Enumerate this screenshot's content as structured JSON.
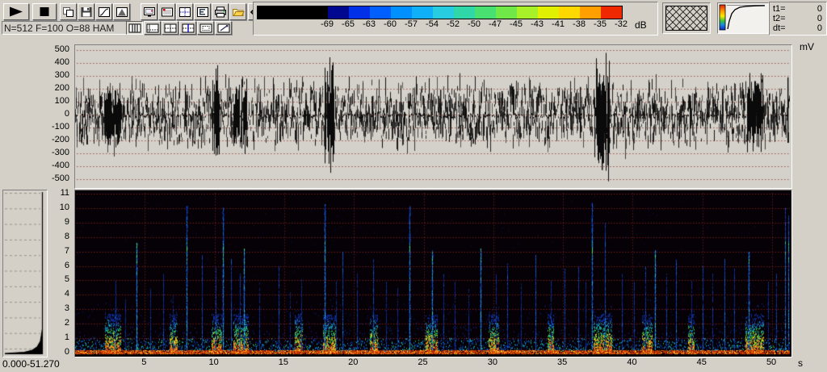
{
  "toolbar": {
    "status_text": "N=512 F=100 O=88 HAM",
    "row1_icons": [
      "play",
      "stop",
      "copy",
      "save",
      "function-curve",
      "triangle-window",
      "display",
      "sonagram-settings",
      "grid-display",
      "fft-params",
      "print",
      "open-file",
      "prev",
      "next"
    ],
    "row2_icons": [
      "view-oscillogram",
      "view-spectrogram",
      "view-split",
      "view-split-cursor",
      "view-zoom",
      "edit-annotate"
    ]
  },
  "colorbar": {
    "unit": "dB",
    "labels": [
      "-69",
      "-65",
      "-63",
      "-60",
      "-57",
      "-54",
      "-52",
      "-50",
      "-47",
      "-45",
      "-43",
      "-41",
      "-38",
      "-35",
      "-32"
    ],
    "lead_color": "#000000",
    "segment_colors": [
      "#000890",
      "#0030e8",
      "#0060ff",
      "#0090ff",
      "#10b0f8",
      "#28cce0",
      "#30d8a8",
      "#48e070",
      "#70e848",
      "#a8f028",
      "#e0f000",
      "#ffd800",
      "#ffa000",
      "#f02800"
    ]
  },
  "cursor_readout": {
    "rows": [
      {
        "label": "t1=",
        "value": "0"
      },
      {
        "label": "t2=",
        "value": "0"
      },
      {
        "label": "dt=",
        "value": "0"
      }
    ]
  },
  "oscillogram": {
    "unit": "mV",
    "y_ticks": [
      "500",
      "400",
      "300",
      "200",
      "100",
      "0",
      "-100",
      "-200",
      "-300",
      "-400",
      "-500"
    ],
    "bg": "#d4d1ca",
    "grid_color": "#a85a4e"
  },
  "spectrogram": {
    "y_ticks": [
      "11",
      "10",
      "9",
      "8",
      "7",
      "6",
      "5",
      "4",
      "3",
      "2",
      "1",
      "0"
    ],
    "x_ticks": [
      "5",
      "10",
      "15",
      "20",
      "25",
      "30",
      "35",
      "40",
      "45",
      "50"
    ],
    "x_unit": "s",
    "range_label": "0.000-51.270",
    "bg": "#060106",
    "grid_color": "#d73c32"
  },
  "chart_data": [
    {
      "type": "line",
      "name": "oscillogram",
      "ylabel": "mV",
      "ylim": [
        -500,
        500
      ],
      "t_range_s": [
        0,
        51.27
      ],
      "noise_band_mv": 90,
      "bursts": [
        [
          2.1,
          3.25,
          190
        ],
        [
          9.9,
          10.35,
          370
        ],
        [
          11.45,
          11.8,
          260
        ],
        [
          11.95,
          12.3,
          280
        ],
        [
          17.95,
          18.55,
          330
        ],
        [
          37.3,
          38.3,
          380
        ],
        [
          48.25,
          49.35,
          270
        ]
      ],
      "spikes": [
        [
          4.5,
          150
        ],
        [
          5.9,
          120
        ],
        [
          7.9,
          200
        ],
        [
          14.2,
          150
        ],
        [
          16.5,
          120
        ],
        [
          21.3,
          160
        ],
        [
          23.0,
          130
        ],
        [
          26.2,
          220
        ],
        [
          26.9,
          140
        ],
        [
          28.0,
          130
        ],
        [
          30.6,
          200
        ],
        [
          33.1,
          150
        ],
        [
          35.2,
          140
        ],
        [
          36.2,
          250
        ],
        [
          37.75,
          -450
        ],
        [
          40.3,
          180
        ],
        [
          42.0,
          140
        ],
        [
          44.1,
          160
        ],
        [
          45.3,
          130
        ],
        [
          46.4,
          200
        ],
        [
          47.1,
          150
        ],
        [
          50.3,
          160
        ],
        [
          51.1,
          330
        ]
      ]
    },
    {
      "type": "heatmap",
      "name": "spectrogram",
      "f_range_khz": [
        0,
        11
      ],
      "t_range_s": [
        0,
        51.27
      ],
      "x_ticks_s": [
        5,
        10,
        15,
        20,
        25,
        30,
        35,
        40,
        45,
        50
      ],
      "y_ticks_khz": [
        0,
        1,
        2,
        3,
        4,
        5,
        6,
        7,
        8,
        9,
        10,
        11
      ],
      "bottom_band_khz": 0.15,
      "calls": [
        [
          2.9,
          5.0,
          0.45
        ],
        [
          3.6,
          4.0,
          0.35
        ],
        [
          4.4,
          7.6,
          0.95
        ],
        [
          5.4,
          4.5,
          0.4
        ],
        [
          6.3,
          5.5,
          0.45
        ],
        [
          7.0,
          4.0,
          0.35
        ],
        [
          8.0,
          10.2,
          0.9
        ],
        [
          9.1,
          6.8,
          0.5
        ],
        [
          10.1,
          6.0,
          0.5
        ],
        [
          10.6,
          10.1,
          0.85
        ],
        [
          11.2,
          6.5,
          0.55
        ],
        [
          11.8,
          5.5,
          0.5
        ],
        [
          12.1,
          7.2,
          0.95
        ],
        [
          13.2,
          5.0,
          0.4
        ],
        [
          14.6,
          6.0,
          0.5
        ],
        [
          15.4,
          4.5,
          0.35
        ],
        [
          16.2,
          5.2,
          0.4
        ],
        [
          17.9,
          10.3,
          0.9
        ],
        [
          18.7,
          5.0,
          0.4
        ],
        [
          19.2,
          7.0,
          0.6
        ],
        [
          20.2,
          5.5,
          0.45
        ],
        [
          21.4,
          6.5,
          0.55
        ],
        [
          22.3,
          5.0,
          0.4
        ],
        [
          23.1,
          4.5,
          0.35
        ],
        [
          24.0,
          10.2,
          0.9
        ],
        [
          25.6,
          7.1,
          0.95
        ],
        [
          26.4,
          5.5,
          0.45
        ],
        [
          27.2,
          5.0,
          0.4
        ],
        [
          28.2,
          4.5,
          0.35
        ],
        [
          29.1,
          7.2,
          0.9
        ],
        [
          30.2,
          5.5,
          0.4
        ],
        [
          31.0,
          6.2,
          0.5
        ],
        [
          32.0,
          4.8,
          0.35
        ],
        [
          33.0,
          6.8,
          0.6
        ],
        [
          34.1,
          5.0,
          0.4
        ],
        [
          35.1,
          5.8,
          0.5
        ],
        [
          36.1,
          6.0,
          0.5
        ],
        [
          36.6,
          5.0,
          0.4
        ],
        [
          37.1,
          10.4,
          0.85
        ],
        [
          38.0,
          9.0,
          0.6
        ],
        [
          39.2,
          5.5,
          0.45
        ],
        [
          40.1,
          5.0,
          0.4
        ],
        [
          40.9,
          6.0,
          0.5
        ],
        [
          41.6,
          7.1,
          0.95
        ],
        [
          42.4,
          5.5,
          0.45
        ],
        [
          43.1,
          6.5,
          0.6
        ],
        [
          44.2,
          5.0,
          0.4
        ],
        [
          45.0,
          6.0,
          0.5
        ],
        [
          45.7,
          5.5,
          0.4
        ],
        [
          46.6,
          6.5,
          0.6
        ],
        [
          47.3,
          5.8,
          0.45
        ],
        [
          48.3,
          7.0,
          0.8
        ],
        [
          49.7,
          5.0,
          0.4
        ],
        [
          50.3,
          5.5,
          0.45
        ],
        [
          50.9,
          10.0,
          0.7
        ],
        [
          51.15,
          9.5,
          0.75
        ]
      ],
      "low_freq_blobs": [
        [
          2.2,
          3.3
        ],
        [
          6.8,
          7.3
        ],
        [
          9.8,
          10.5
        ],
        [
          11.4,
          12.4
        ],
        [
          15.8,
          16.3
        ],
        [
          17.8,
          18.7
        ],
        [
          21.2,
          21.7
        ],
        [
          25.2,
          26.0
        ],
        [
          29.7,
          30.4
        ],
        [
          33.9,
          34.3
        ],
        [
          37.2,
          38.5
        ],
        [
          40.7,
          41.4
        ],
        [
          44.0,
          44.4
        ],
        [
          48.1,
          49.4
        ]
      ]
    },
    {
      "type": "area",
      "name": "mean-spectrum-profile",
      "f_range_khz": [
        0,
        11
      ],
      "peak_at_khz": 0
    }
  ]
}
